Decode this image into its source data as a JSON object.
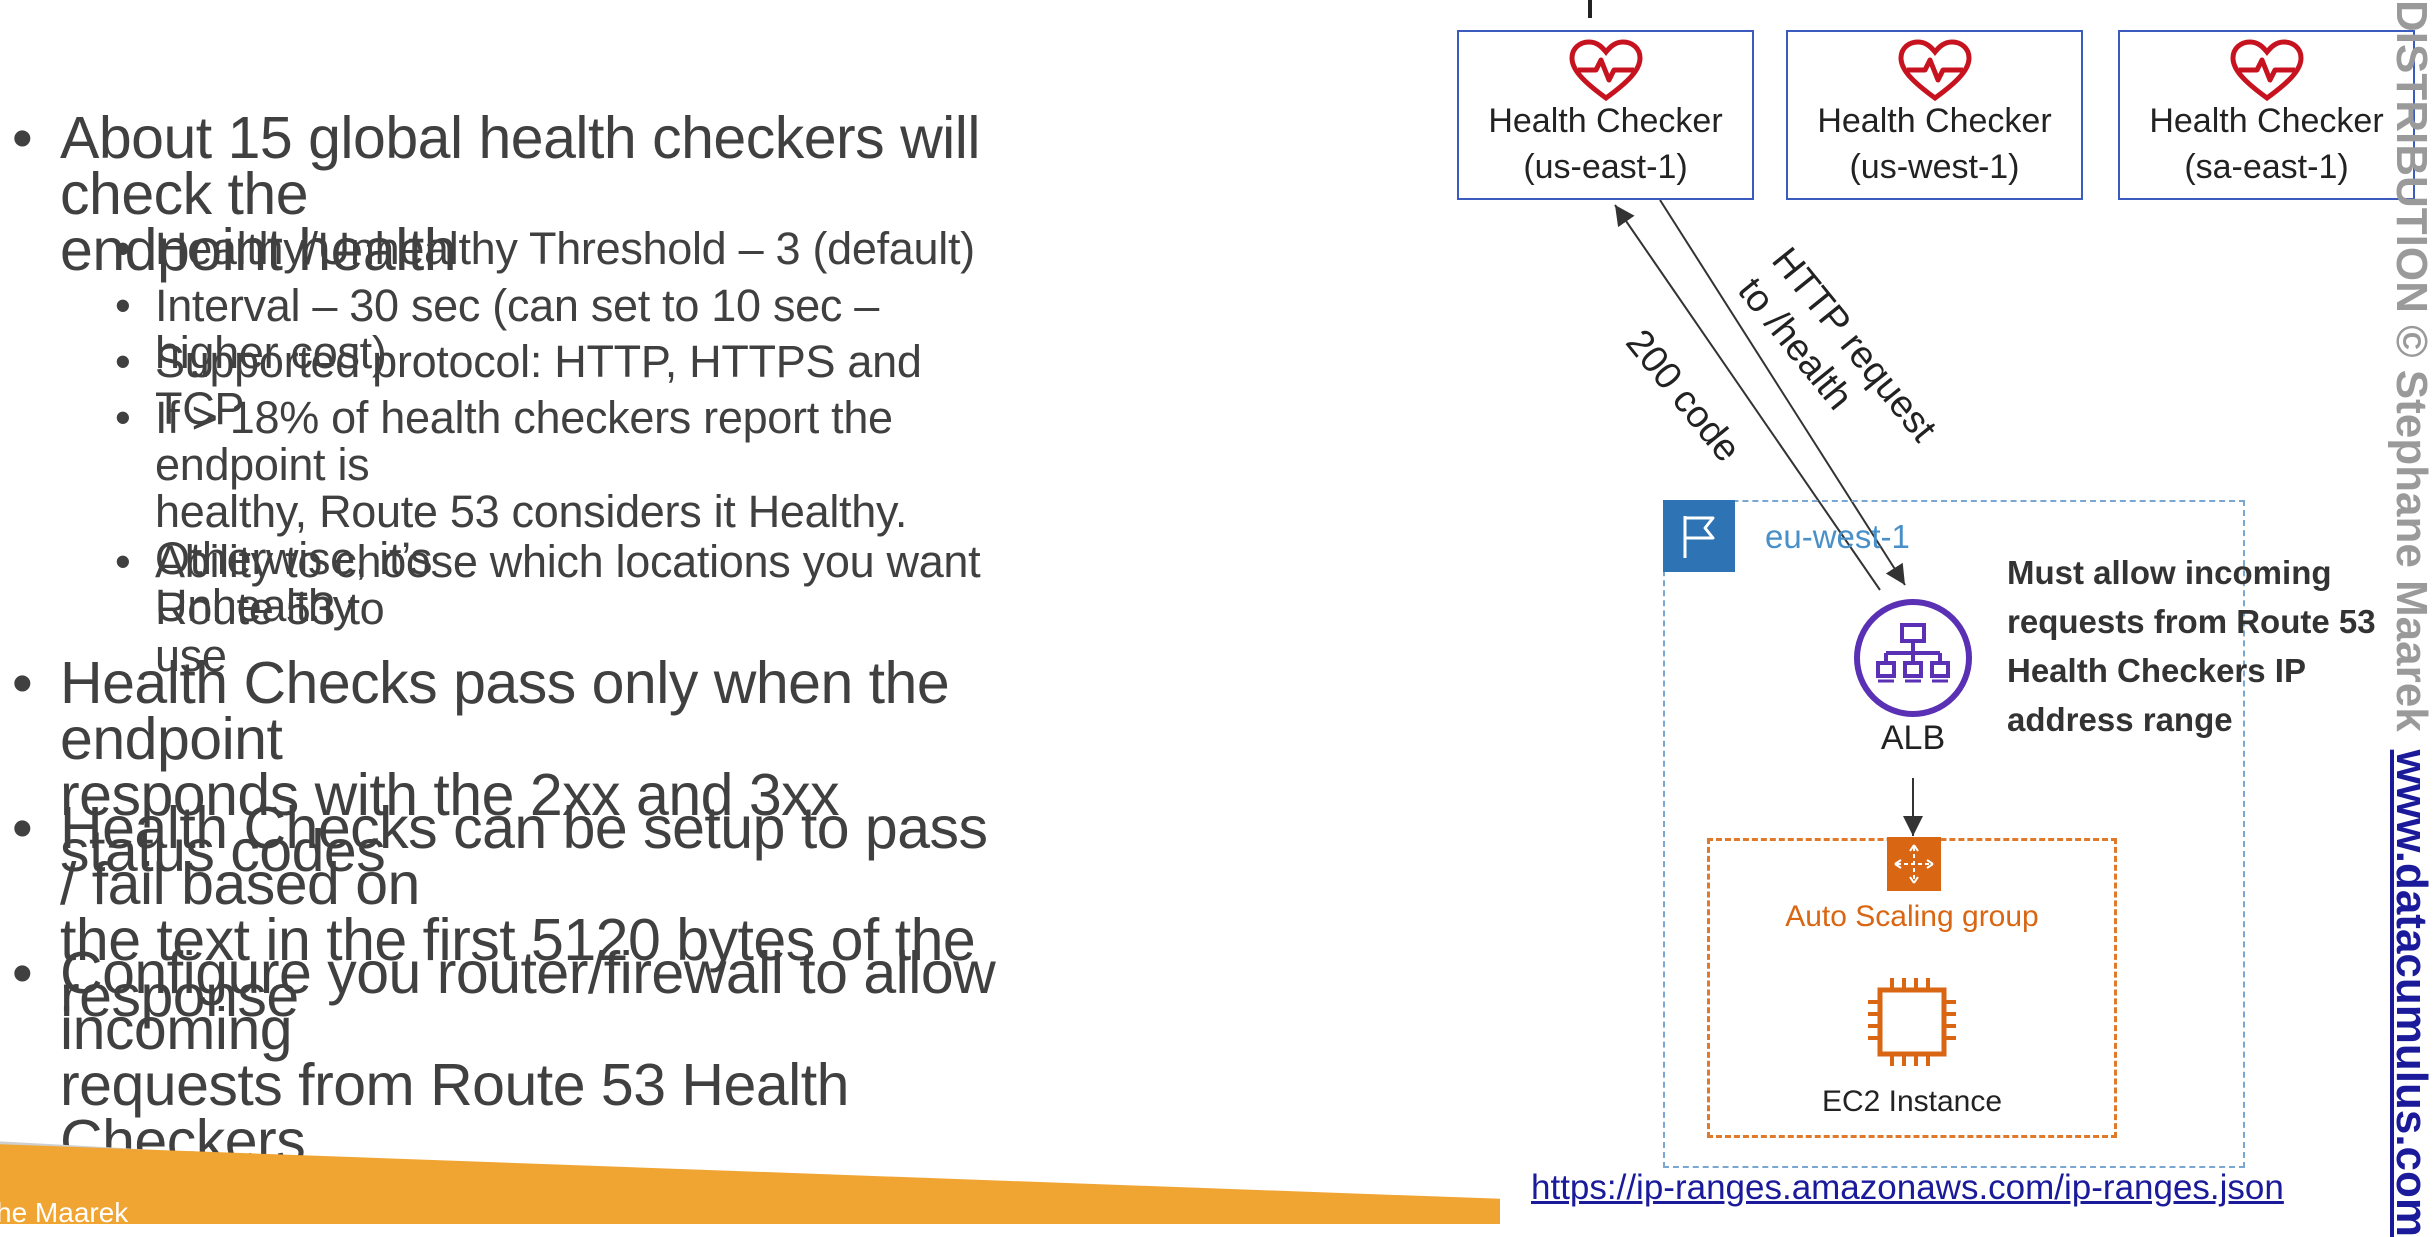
{
  "bullets": [
    {
      "level": 1,
      "lines": [
        "About 15 global health checkers will check the",
        "endpoint health"
      ]
    },
    {
      "level": 2,
      "lines": [
        "Healthy/Unhealthy Threshold – 3 (default)"
      ]
    },
    {
      "level": 2,
      "lines": [
        "Interval – 30 sec (can set to 10 sec – higher cost)"
      ]
    },
    {
      "level": 2,
      "lines": [
        "Supported protocol: HTTP,  HTTPS and TCP"
      ]
    },
    {
      "level": 2,
      "lines": [
        "If  > 18% of health checkers report the endpoint is",
        "healthy, Route 53 considers it Healthy. Otherwise, it’s",
        "Unhealthy"
      ]
    },
    {
      "level": 2,
      "lines": [
        "Ability to choose which locations you want Route 53 to",
        "use"
      ]
    },
    {
      "level": 1,
      "lines": [
        "Health Checks pass only when the endpoint",
        "responds with the 2xx and 3xx status codes"
      ]
    },
    {
      "level": 1,
      "lines": [
        "Health Checks can be setup to pass / fail based on",
        "the text in the first 5120 bytes of the response"
      ]
    },
    {
      "level": 1,
      "lines": [
        "Configure you router/firewall to allow incoming",
        "requests from Route 53 Health Checkers"
      ]
    }
  ],
  "diagram": {
    "health_checkers": [
      {
        "title": "Health Checker",
        "region": "(us-east-1)"
      },
      {
        "title": "Health Checker",
        "region": "(us-west-1)"
      },
      {
        "title": "Health Checker",
        "region": "(sa-east-1)"
      }
    ],
    "request_label_line1": "HTTP request",
    "request_label_line2": "to /health",
    "response_label": "200 code",
    "region_label": "eu-west-1",
    "alb_label": "ALB",
    "note_lines": [
      "Must allow incoming",
      "requests from Route 53",
      "Health Checkers IP",
      "address range"
    ],
    "asg_label": "Auto Scaling group",
    "ec2_label": "EC2 Instance",
    "ip_ranges_link": "https://ip-ranges.amazonaws.com/ip-ranges.json"
  },
  "footer": {
    "author": "he Maarek"
  },
  "watermark": {
    "text": "DISTRIBUTION © Stephane Maarek",
    "url": "www.datacumulus.com"
  },
  "colors": {
    "health_checker_border": "#3b5bbe",
    "heart_icon": "#c7131f",
    "region_flag": "#2e74b5",
    "alb_icon": "#5a30b5",
    "asg_orange": "#d86613",
    "footer_orange": "#f0a432"
  },
  "icons": {
    "health_checker": "heart-pulse-icon",
    "region": "flag-icon",
    "alb": "load-balancer-icon",
    "asg": "auto-scaling-icon",
    "ec2": "chip-icon"
  }
}
